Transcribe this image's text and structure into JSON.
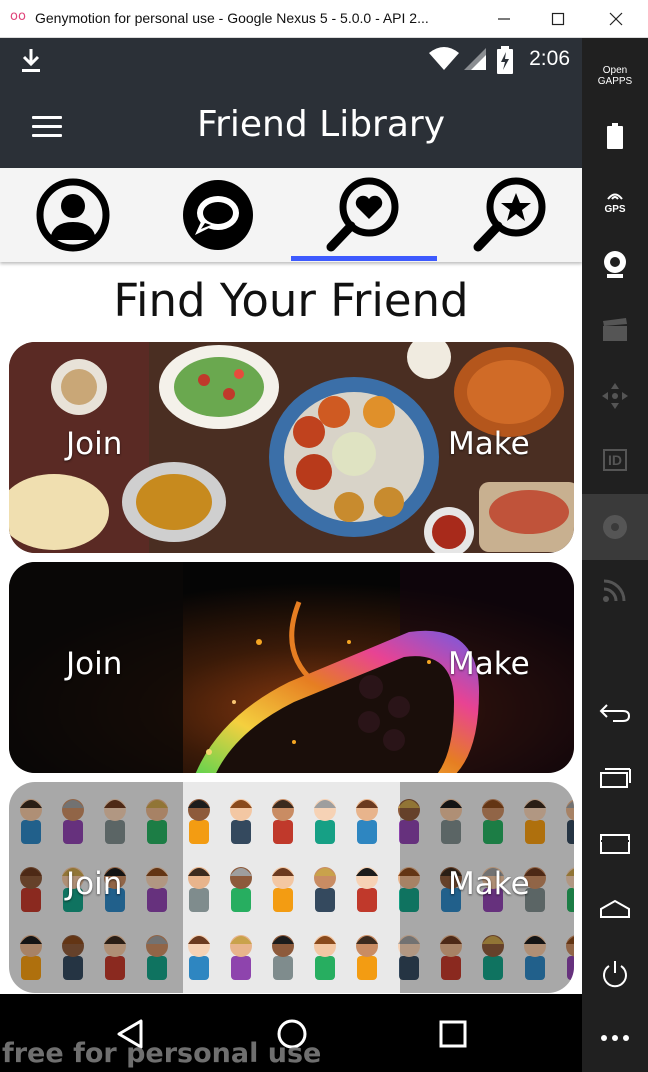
{
  "window": {
    "logo": "oo",
    "title": "Genymotion for personal use - Google Nexus 5 - 5.0.0 - API 2...",
    "controls": [
      "minimize-icon",
      "maximize-icon",
      "close-icon"
    ]
  },
  "statusbar": {
    "time": "2:06"
  },
  "appbar": {
    "title": "Friend Library"
  },
  "tabs": [
    {
      "icon": "profile-icon",
      "selected": false
    },
    {
      "icon": "chat-icon",
      "selected": false
    },
    {
      "icon": "search-heart-icon",
      "selected": true
    },
    {
      "icon": "search-star-icon",
      "selected": false
    }
  ],
  "heading": "Find Your Friend",
  "cards": [
    {
      "theme": "food",
      "join": "Join",
      "make": "Make"
    },
    {
      "theme": "game",
      "join": "Join",
      "make": "Make"
    },
    {
      "theme": "people",
      "join": "Join",
      "make": "Make"
    }
  ],
  "sidebar": {
    "opengapps": "Open\nGAPPS",
    "gps": "GPS",
    "id": "ID"
  },
  "watermark": "free for personal use",
  "colors": {
    "appbar": "#2b3037",
    "tab_indicator": "#3d5afe",
    "sidebar": "#202020"
  }
}
